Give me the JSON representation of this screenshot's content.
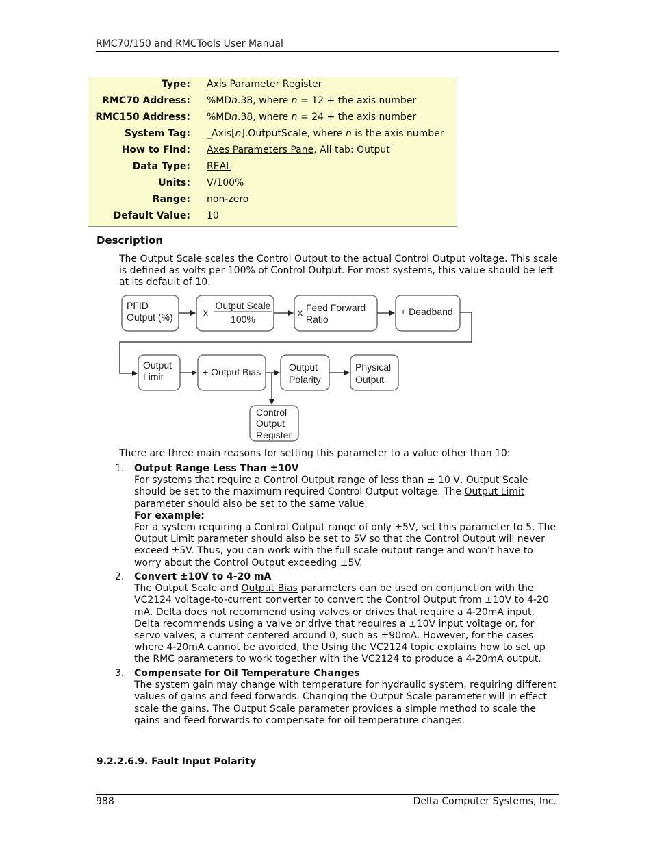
{
  "header": {
    "title": "RMC70/150 and RMCTools User Manual"
  },
  "param_table": {
    "rows": [
      {
        "label": "Type:",
        "value_link": "Axis Parameter Register"
      },
      {
        "label": "RMC70 Address:",
        "value_pre": "%MD",
        "value_var": "n",
        "value_mid": ".38, where ",
        "value_var2": "n",
        "value_post": " = 12 + the axis number"
      },
      {
        "label": "RMC150 Address:",
        "value_pre": "%MD",
        "value_var": "n",
        "value_mid": ".38, where ",
        "value_var2": "n",
        "value_post": " = 24 + the axis number"
      },
      {
        "label": "System Tag:",
        "value_pre": "_Axis[",
        "value_var": "n",
        "value_mid": "].OutputScale, where ",
        "value_var2": "n",
        "value_post": " is the axis number"
      },
      {
        "label": "How to Find:",
        "value_link": "Axes Parameters Pane",
        "value_post": ", All tab: Output"
      },
      {
        "label": "Data Type:",
        "value_link": "REAL"
      },
      {
        "label": "Units:",
        "value": "V/100%"
      },
      {
        "label": "Range:",
        "value": "non-zero"
      },
      {
        "label": "Default Value:",
        "value": "10"
      }
    ]
  },
  "description": {
    "heading": "Description",
    "text": "The Output Scale scales the Control Output to the actual Control Output voltage. This scale is defined as volts per 100% of Control Output. For most systems, this value should be left at its default of 10."
  },
  "diagram": {
    "blocks": {
      "pfid": [
        "PFID",
        "Output (%)"
      ],
      "scale_prefix": "x",
      "scale_num": "Output Scale",
      "scale_den": "100%",
      "ff_prefix": "x",
      "ff": [
        "Feed Forward",
        "Ratio"
      ],
      "deadband": "+ Deadband",
      "limit": [
        "Output",
        "Limit"
      ],
      "bias": "+ Output Bias",
      "polarity": [
        "Output",
        "Polarity"
      ],
      "physical": [
        "Physical",
        "Output"
      ],
      "register": [
        "Control",
        "Output",
        "Register"
      ]
    }
  },
  "reasons": {
    "intro": "There are three main reasons for setting this parameter to a value other than 10:",
    "items": [
      {
        "num": "1.",
        "title": "Output Range Less Than ±10V",
        "p1_a": "For systems that require a Control Output range of less than ± 10 V, Output Scale should be set to the maximum required Control Output voltage. The ",
        "p1_link": "Output Limit",
        "p1_b": " parameter should also be set to the same value.",
        "example_label": "For example:",
        "p2_a": "For a system requiring a Control Output range of only ±5V, set this parameter to 5. The ",
        "p2_link": "Output Limit",
        "p2_b": " parameter should also be set to 5V so that the Control Output will never exceed ±5V. Thus, you can work with the full scale output range and won't have to worry about the Control Output exceeding ±5V."
      },
      {
        "num": "2.",
        "title": "Convert ±10V to 4-20 mA",
        "a": "The Output Scale and ",
        "link1": "Output Bias",
        "b": " parameters can be used on conjunction with the VC2124 voltage-to-current converter to convert the ",
        "link2": "Control Output",
        "c": " from ±10V to 4-20 mA. Delta does not recommend using valves or drives that require a 4-20mA input. Delta recommends using a valve or drive that requires a ±10V input voltage or, for servo valves, a current centered around 0, such as ±90mA. However, for the cases where 4-20mA cannot be avoided, the ",
        "link3": "Using the VC2124",
        "d": " topic explains how to set up the RMC parameters to work together with the VC2124 to produce a 4-20mA output."
      },
      {
        "num": "3.",
        "title": "Compensate for Oil Temperature Changes",
        "text": "The system gain may change with temperature for hydraulic system, requiring different values of gains and feed forwards. Changing the Output Scale parameter will in effect scale the gains. The Output Scale parameter provides a simple method to scale the gains and feed forwards to compensate for oil temperature changes."
      }
    ]
  },
  "next_section": {
    "heading": "9.2.2.6.9. Fault Input Polarity"
  },
  "footer": {
    "page_number": "988",
    "company": "Delta Computer Systems, Inc."
  }
}
